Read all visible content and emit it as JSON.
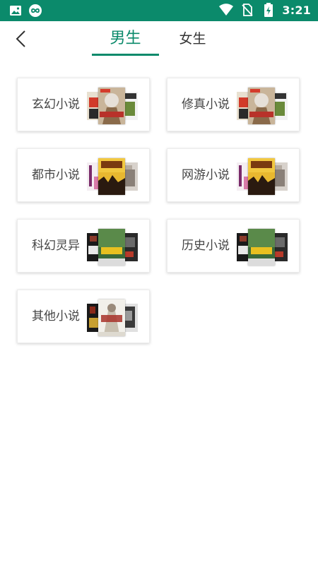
{
  "status_bar": {
    "time": "3:21",
    "left_icons": [
      "image-icon",
      "infinity-app-icon"
    ],
    "right_icons": [
      "wifi-icon",
      "no-sim-icon",
      "battery-charging-icon"
    ],
    "background": "#0b8a6b"
  },
  "header": {
    "back_icon": "chevron-left-icon",
    "tabs": [
      {
        "label": "男生",
        "active": true
      },
      {
        "label": "女生",
        "active": false
      }
    ],
    "accent": "#0b8a6b"
  },
  "categories": [
    {
      "label": "玄幻小说",
      "cover_style": "fantasy"
    },
    {
      "label": "修真小说",
      "cover_style": "fantasy"
    },
    {
      "label": "都市小说",
      "cover_style": "urban"
    },
    {
      "label": "网游小说",
      "cover_style": "urban"
    },
    {
      "label": "科幻灵异",
      "cover_style": "scifi"
    },
    {
      "label": "历史小说",
      "cover_style": "scifi"
    },
    {
      "label": "其他小说",
      "cover_style": "other"
    }
  ]
}
